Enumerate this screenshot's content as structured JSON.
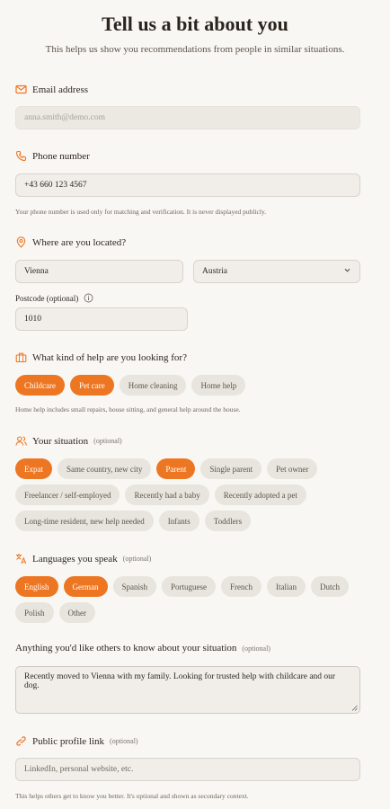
{
  "header": {
    "title": "Tell us a bit about you",
    "subtitle": "This helps us show you recommendations from people in similar situations."
  },
  "email": {
    "label": "Email address",
    "value": "anna.smith@demo.com",
    "icon": "mail-icon"
  },
  "phone": {
    "label": "Phone number",
    "value": "+43 660 123 4567",
    "hint": "Your phone number is used only for matching and verification. It is never displayed publicly.",
    "icon": "phone-icon"
  },
  "location": {
    "label": "Where are you located?",
    "city": "Vienna",
    "country": "Austria",
    "postcode_label": "Postcode (optional)",
    "postcode": "1010",
    "icon": "location-pin-icon"
  },
  "help": {
    "label": "What kind of help are you looking for?",
    "options": [
      {
        "label": "Childcare",
        "selected": true
      },
      {
        "label": "Pet care",
        "selected": true
      },
      {
        "label": "Home cleaning",
        "selected": false
      },
      {
        "label": "Home help",
        "selected": false
      }
    ],
    "hint": "Home help includes small repairs, house sitting, and general help around the house.",
    "icon": "briefcase-icon"
  },
  "situation": {
    "label": "Your situation",
    "optional": "(optional)",
    "options": [
      {
        "label": "Expat",
        "selected": true
      },
      {
        "label": "Same country, new city",
        "selected": false
      },
      {
        "label": "Parent",
        "selected": true
      },
      {
        "label": "Single parent",
        "selected": false
      },
      {
        "label": "Pet owner",
        "selected": false
      },
      {
        "label": "Freelancer / self-employed",
        "selected": false
      },
      {
        "label": "Recently had a baby",
        "selected": false
      },
      {
        "label": "Recently adopted a pet",
        "selected": false
      },
      {
        "label": "Long-time resident, new help needed",
        "selected": false
      },
      {
        "label": "Infants",
        "selected": false
      },
      {
        "label": "Toddlers",
        "selected": false
      }
    ],
    "icon": "users-icon"
  },
  "languages": {
    "label": "Languages you speak",
    "optional": "(optional)",
    "options": [
      {
        "label": "English",
        "selected": true
      },
      {
        "label": "German",
        "selected": true
      },
      {
        "label": "Spanish",
        "selected": false
      },
      {
        "label": "Portuguese",
        "selected": false
      },
      {
        "label": "French",
        "selected": false
      },
      {
        "label": "Italian",
        "selected": false
      },
      {
        "label": "Dutch",
        "selected": false
      },
      {
        "label": "Polish",
        "selected": false
      },
      {
        "label": "Other",
        "selected": false
      }
    ],
    "icon": "translate-icon"
  },
  "about": {
    "label": "Anything you'd like others to know about your situation",
    "optional": "(optional)",
    "value": "Recently moved to Vienna with my family. Looking for trusted help with childcare and our dog."
  },
  "profile_link": {
    "label": "Public profile link",
    "optional": "(optional)",
    "placeholder": "LinkedIn, personal website, etc.",
    "hint": "This helps others get to know you better. It's optional and shown as secondary context.",
    "icon": "link-icon"
  },
  "colors": {
    "accent": "#ed7622",
    "chip_bg": "#e8e4de",
    "background": "#f9f7f3"
  }
}
